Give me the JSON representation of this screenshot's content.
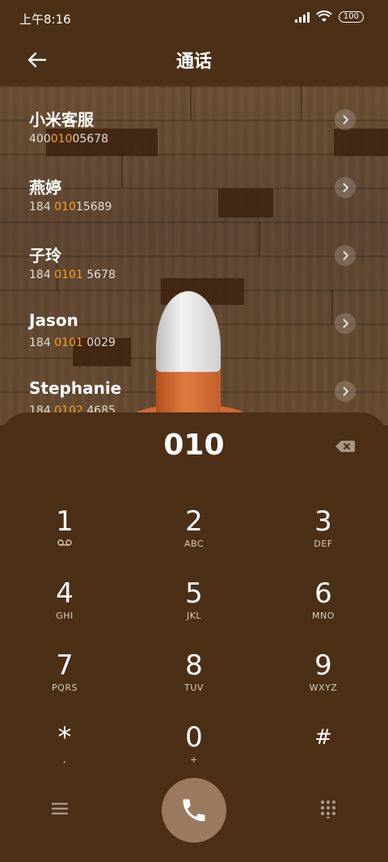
{
  "status_bar": {
    "time": "上午8:16",
    "battery": "100",
    "icons": [
      "signal-icon",
      "wifi-icon",
      "battery-icon"
    ]
  },
  "header": {
    "title": "通话",
    "back_icon": "back-arrow-icon"
  },
  "contacts": [
    {
      "name": "小米客服",
      "number_pre": "400",
      "number_match": "010",
      "number_post": "05678"
    },
    {
      "name": "燕婷",
      "number_pre": "184 ",
      "number_match": "010",
      "number_post": "15689"
    },
    {
      "name": "子玲",
      "number_pre": "184 ",
      "number_match": "0101",
      "number_post": " 5678"
    },
    {
      "name": "Jason",
      "number_pre": "184 ",
      "number_match": "0101",
      "number_post": " 0029"
    },
    {
      "name": "Stephanie",
      "number_pre": "184 ",
      "number_match": "0102",
      "number_post": " 4685"
    }
  ],
  "dialpad": {
    "entered_number": "010",
    "keys": [
      {
        "digit": "1",
        "letters": "voicemail-icon"
      },
      {
        "digit": "2",
        "letters": "ABC"
      },
      {
        "digit": "3",
        "letters": "DEF"
      },
      {
        "digit": "4",
        "letters": "GHI"
      },
      {
        "digit": "5",
        "letters": "JKL"
      },
      {
        "digit": "6",
        "letters": "MNO"
      },
      {
        "digit": "7",
        "letters": "PQRS"
      },
      {
        "digit": "8",
        "letters": "TUV"
      },
      {
        "digit": "9",
        "letters": "WXYZ"
      },
      {
        "digit": "*",
        "letters": ","
      },
      {
        "digit": "0",
        "letters": "+"
      },
      {
        "digit": "#",
        "letters": ""
      }
    ]
  },
  "colors": {
    "background": "#4b2f16",
    "highlight": "#f5a11f",
    "call_button": "#9b7b60"
  }
}
